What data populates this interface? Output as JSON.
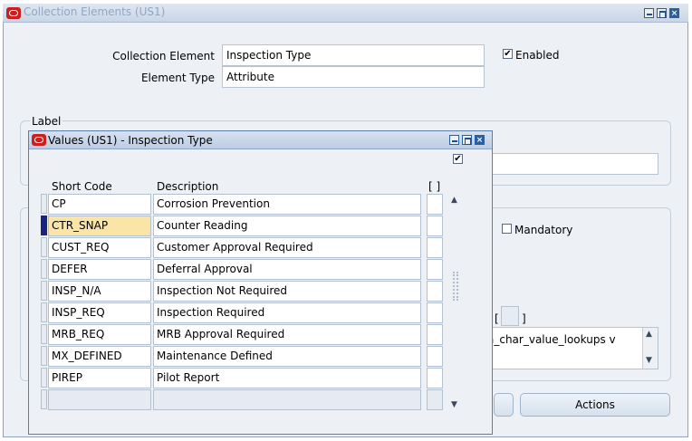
{
  "window": {
    "title": "Collection Elements (US1)"
  },
  "form": {
    "collection_element_label": "Collection Element",
    "collection_element_value": "Inspection Type",
    "element_type_label": "Element Type",
    "element_type_value": "Attribute",
    "enabled_label": "Enabled",
    "enabled_checked": true,
    "label_group_title": "Label",
    "mandatory_label": "Mandatory",
    "mandatory_checked": false,
    "sql_text": "a_char_value_lookups v",
    "bracket_left": "[",
    "bracket_right": "]",
    "actions_button": "Actions"
  },
  "dialog": {
    "title": "Values (US1) - Inspection Type",
    "header_checkbox_checked": true,
    "columns": {
      "short_code": "Short Code",
      "description": "Description",
      "flag": "[ ]"
    },
    "rows": [
      {
        "short_code": "CP",
        "description": "Corrosion Prevention"
      },
      {
        "short_code": "CTR_SNAP",
        "description": "Counter Reading"
      },
      {
        "short_code": "CUST_REQ",
        "description": "Customer Approval Required"
      },
      {
        "short_code": "DEFER",
        "description": "Deferral Approval"
      },
      {
        "short_code": "INSP_N/A",
        "description": "Inspection Not Required"
      },
      {
        "short_code": "INSP_REQ",
        "description": "Inspection Required"
      },
      {
        "short_code": "MRB_REQ",
        "description": "MRB Approval Required"
      },
      {
        "short_code": "MX_DEFINED",
        "description": "Maintenance Defined"
      },
      {
        "short_code": "PIREP",
        "description": "Pilot Report"
      },
      {
        "short_code": "",
        "description": ""
      }
    ],
    "current_row_index": 1
  }
}
